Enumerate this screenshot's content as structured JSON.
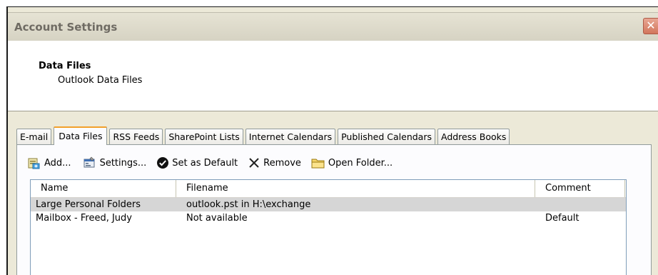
{
  "window": {
    "title": "Account Settings",
    "close_glyph": "✕"
  },
  "header": {
    "title": "Data Files",
    "subtitle": "Outlook Data Files"
  },
  "tabs": [
    {
      "label": "E-mail",
      "active": false
    },
    {
      "label": "Data Files",
      "active": true
    },
    {
      "label": "RSS Feeds",
      "active": false
    },
    {
      "label": "SharePoint Lists",
      "active": false
    },
    {
      "label": "Internet Calendars",
      "active": false
    },
    {
      "label": "Published Calendars",
      "active": false
    },
    {
      "label": "Address Books",
      "active": false
    }
  ],
  "toolbar": {
    "add_label": "Add...",
    "settings_label": "Settings...",
    "set_default_label": "Set as Default",
    "remove_label": "Remove",
    "open_folder_label": "Open Folder..."
  },
  "list": {
    "columns": [
      "Name",
      "Filename",
      "Comment"
    ],
    "rows": [
      {
        "name": "Large Personal Folders",
        "filename": "outlook.pst in H:\\exchange",
        "comment": "",
        "selected": true
      },
      {
        "name": "Mailbox - Freed, Judy",
        "filename": "Not available",
        "comment": "Default",
        "selected": false
      }
    ]
  },
  "colors": {
    "active_tab_accent": "#f2a02a",
    "close_button": "#d2765c",
    "selection": "#d6d6d6"
  }
}
